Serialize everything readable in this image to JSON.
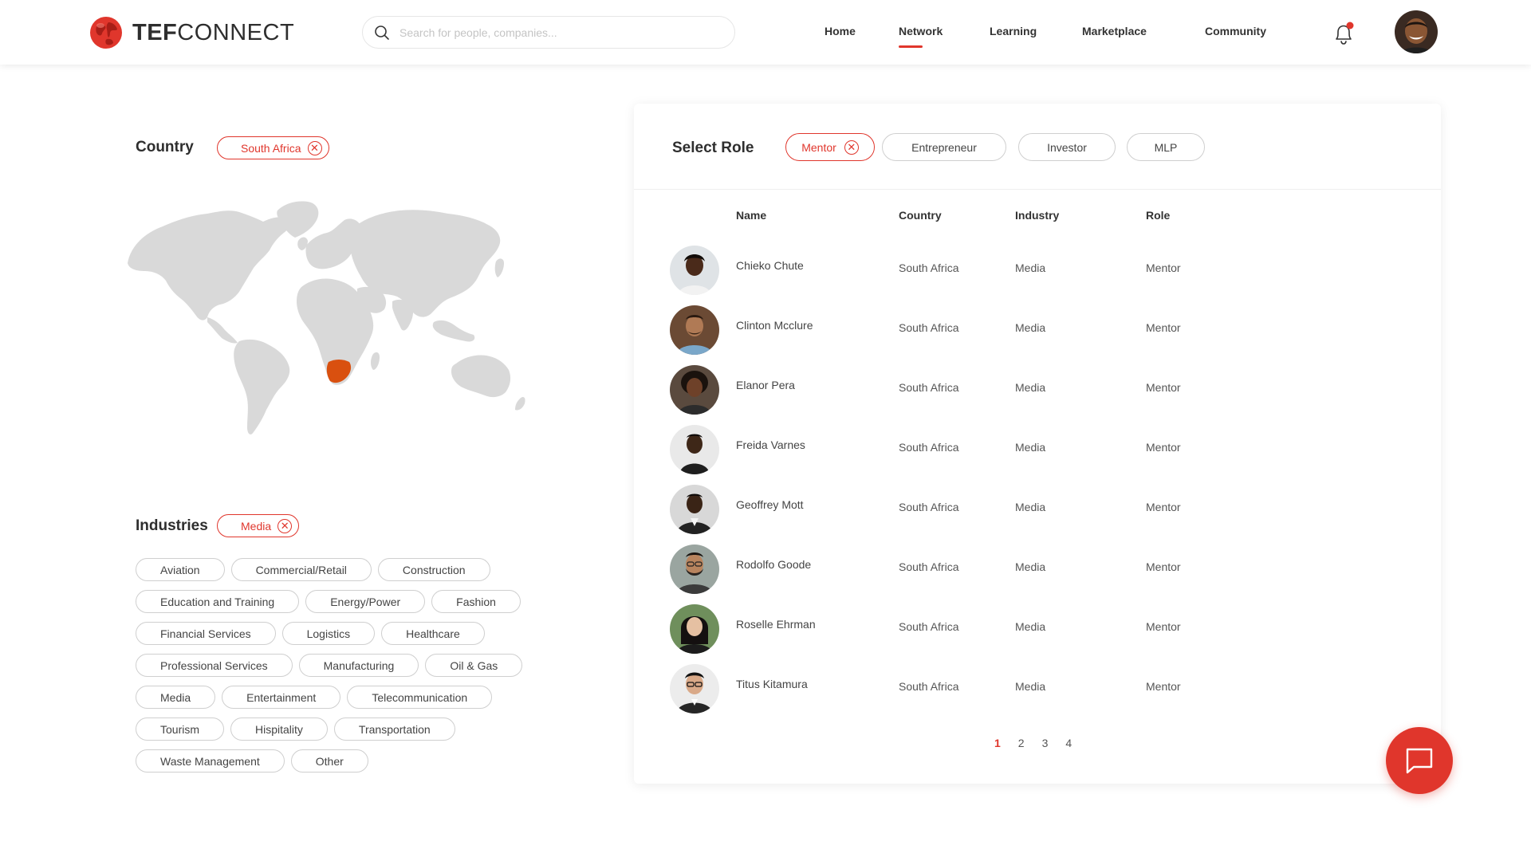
{
  "header": {
    "brand_bold": "TEF",
    "brand_light": "CONNECT",
    "search_placeholder": "Search for people, companies...",
    "nav": [
      {
        "label": "Home",
        "active": false
      },
      {
        "label": "Network",
        "active": true
      },
      {
        "label": "Learning",
        "active": false
      },
      {
        "label": "Marketplace",
        "active": false
      },
      {
        "label": "Community",
        "active": false
      }
    ],
    "notification_icon": "bell-icon",
    "notification_dot_color": "#e0362c"
  },
  "filters": {
    "country_label": "Country",
    "country_selected": "South Africa",
    "industries_label": "Industries",
    "industry_selected": "Media",
    "industry_options": [
      [
        "Aviation",
        "Commercial/Retail",
        "Construction"
      ],
      [
        "Education and Training",
        "Energy/Power",
        "Fashion"
      ],
      [
        "Financial Services",
        "Logistics",
        "Healthcare"
      ],
      [
        "Professional Services",
        "Manufacturing",
        "Oil & Gas"
      ],
      [
        "Media",
        "Entertainment",
        "Telecommunication"
      ],
      [
        "Tourism",
        "Hispitality",
        "Transportation"
      ],
      [
        "Waste Management",
        "Other"
      ]
    ]
  },
  "roles": {
    "label": "Select Role",
    "selected": "Mentor",
    "options": [
      "Entrepreneur",
      "Investor",
      "MLP"
    ]
  },
  "table": {
    "headers": {
      "name": "Name",
      "country": "Country",
      "industry": "Industry",
      "role": "Role"
    },
    "rows": [
      {
        "name": "Chieko Chute",
        "country": "South Africa",
        "industry": "Media",
        "role": "Mentor"
      },
      {
        "name": "Clinton Mcclure",
        "country": "South Africa",
        "industry": "Media",
        "role": "Mentor"
      },
      {
        "name": "Elanor Pera",
        "country": "South Africa",
        "industry": "Media",
        "role": "Mentor"
      },
      {
        "name": "Freida Varnes",
        "country": "South Africa",
        "industry": "Media",
        "role": "Mentor"
      },
      {
        "name": "Geoffrey Mott",
        "country": "South Africa",
        "industry": "Media",
        "role": "Mentor"
      },
      {
        "name": "Rodolfo Goode",
        "country": "South Africa",
        "industry": "Media",
        "role": "Mentor"
      },
      {
        "name": "Roselle Ehrman",
        "country": "South Africa",
        "industry": "Media",
        "role": "Mentor"
      },
      {
        "name": "Titus Kitamura",
        "country": "South Africa",
        "industry": "Media",
        "role": "Mentor"
      }
    ]
  },
  "pagination": {
    "pages": [
      "1",
      "2",
      "3",
      "4"
    ],
    "current": "1"
  },
  "colors": {
    "accent": "#e0362c",
    "map_land": "#d9d9d9",
    "map_highlight": "#d9500f"
  }
}
